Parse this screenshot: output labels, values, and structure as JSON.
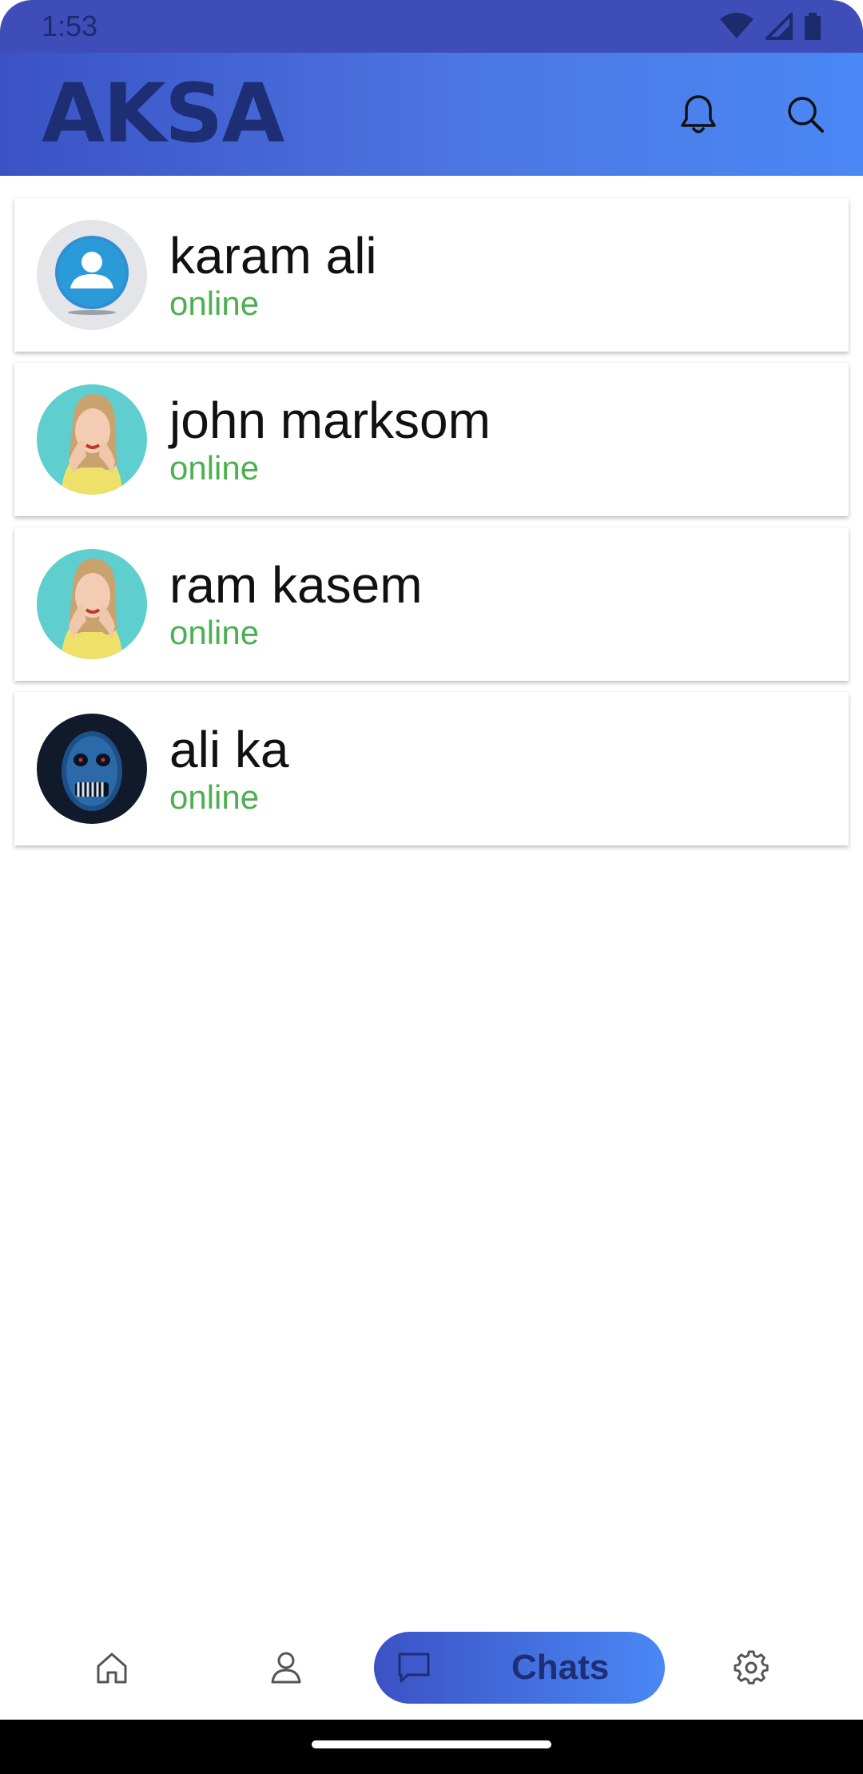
{
  "status_bar": {
    "time": "1:53"
  },
  "app_bar": {
    "title": "AKSA",
    "actions": [
      {
        "icon": "bell-icon"
      },
      {
        "icon": "search-icon"
      }
    ]
  },
  "chats": [
    {
      "name": "karam ali",
      "status": "online",
      "avatar": "default-user-avatar"
    },
    {
      "name": "john marksom",
      "status": "online",
      "avatar": "woman-photo-avatar"
    },
    {
      "name": "ram kasem",
      "status": "online",
      "avatar": "woman-photo-avatar"
    },
    {
      "name": "ali ka",
      "status": "online",
      "avatar": "blue-skull-avatar"
    }
  ],
  "bottom_nav": {
    "items": [
      {
        "icon": "home-icon"
      },
      {
        "icon": "person-icon"
      },
      {
        "icon": "chat-bubble-icon",
        "label": "Chats",
        "active": true
      },
      {
        "icon": "gear-icon"
      }
    ]
  },
  "colors": {
    "status_bar": "#3f4db8",
    "app_bar_start": "#3b52c4",
    "app_bar_end": "#4a88f5",
    "title": "#1d2e74",
    "online": "#4caf50"
  }
}
